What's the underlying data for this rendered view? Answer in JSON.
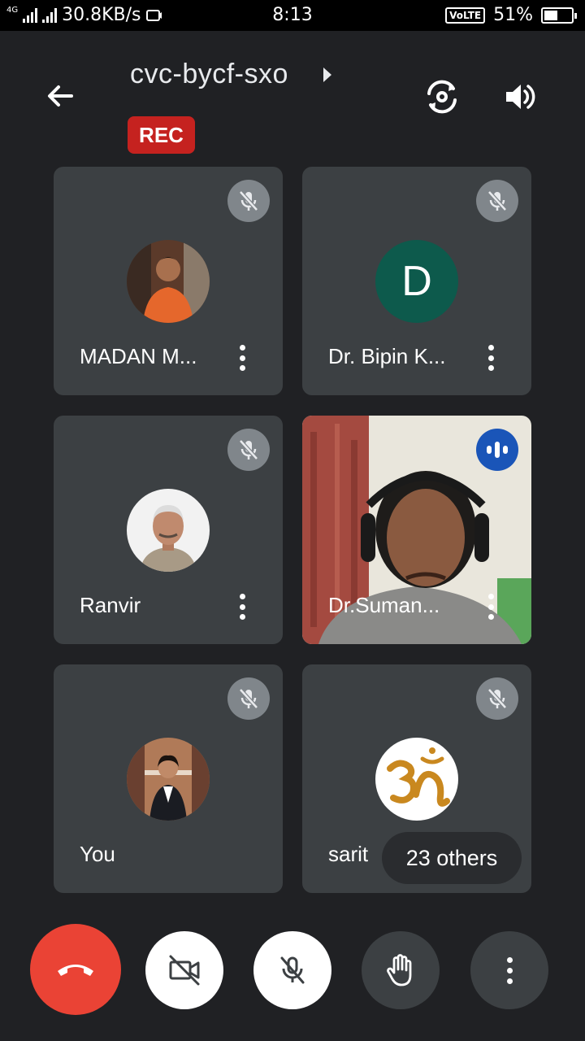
{
  "status_bar": {
    "network_type": "4G",
    "data_speed": "30.8KB/s",
    "time": "8:13",
    "volte": "VoLTE",
    "battery": "51%",
    "battery_level": 0.51
  },
  "header": {
    "meeting_code": "cvc-bycf-sxo",
    "rec_label": "REC"
  },
  "participants": [
    {
      "name": "MADAN M...",
      "avatar": "photo-man-orange",
      "muted": true
    },
    {
      "name": "Dr. Bipin K...",
      "avatar_letter": "D",
      "avatar_color": "#0d5a4c",
      "muted": true
    },
    {
      "name": "Ranvir",
      "avatar": "photo-elderly-man",
      "muted": true
    },
    {
      "name": "Dr.Suman...",
      "video": true,
      "speaking": true
    },
    {
      "name": "You",
      "avatar": "photo-woman-suit",
      "muted": true
    },
    {
      "name": "sarit",
      "avatar": "om-symbol",
      "muted": true,
      "others_label": "23 others"
    }
  ],
  "controls": {
    "end_call": "phone-end-icon",
    "camera": "video-off-icon",
    "mic": "mic-off-icon",
    "raise_hand": "hand-icon",
    "more": "more-vert-icon"
  },
  "colors": {
    "background": "#202124",
    "tile": "#3c4043",
    "rec": "#c5221f",
    "end_call": "#ea4335",
    "speaking": "#1a55b8"
  }
}
